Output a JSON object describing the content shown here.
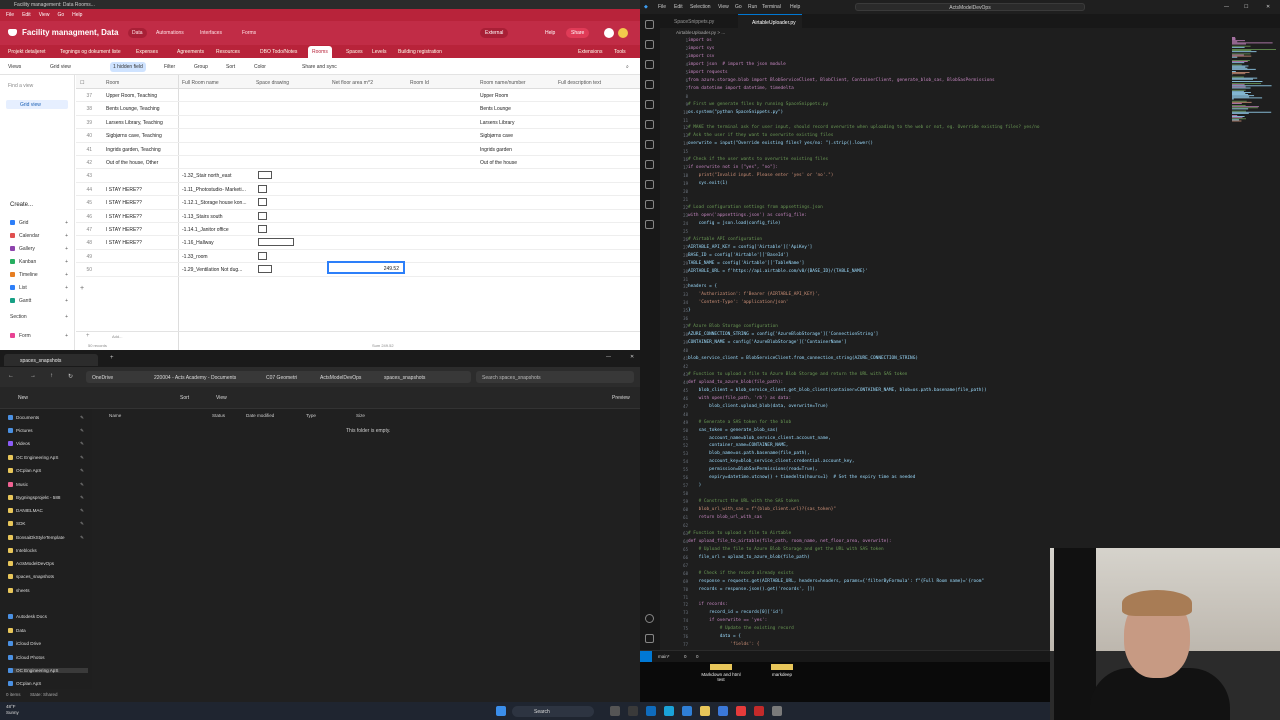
{
  "airtable": {
    "window_title": "Facility management: Data Rooms...",
    "menu": [
      "File",
      "Edit",
      "View",
      "Go",
      "Help"
    ],
    "base_title": "Facility managment, Data",
    "nav": [
      "Data",
      "Automations",
      "Interfaces",
      "Forms"
    ],
    "nav_active": "Data",
    "external_label": "External",
    "help_label": "Help",
    "share_label": "Share",
    "tables": [
      "Projekt detaljeret",
      "Tegnings og dokument liste",
      "Expenses",
      "Agreements",
      "Resources",
      "DBO Todo/Notes",
      "Rooms",
      "Spaces",
      "Levels",
      "Building registration"
    ],
    "active_table": "Rooms",
    "extensions_label": "Extensions",
    "tools_label": "Tools",
    "toolbar": {
      "views": "Views",
      "grid_view": "Grid view",
      "hidden": "1 hidden field",
      "filter": "Filter",
      "group": "Group",
      "sort": "Sort",
      "color": "Color",
      "share_sync": "Share and sync"
    },
    "sidebar": {
      "find": "Find a view",
      "grid_view": "Grid view",
      "create": "Create...",
      "items": [
        "Grid",
        "Calendar",
        "Gallery",
        "Kanban",
        "Timeline",
        "List",
        "Gantt",
        "Section",
        "Form"
      ]
    },
    "columns": [
      "Room",
      "Full Room name",
      "Space drawing",
      "Net floor area m^2",
      "Room Id",
      "Room name/number",
      "Full description text"
    ],
    "rows": [
      {
        "n": "37",
        "room": "Upper Room, Teaching",
        "full": "",
        "thumb": false,
        "number": "Upper Room"
      },
      {
        "n": "38",
        "room": "Bents Lounge, Teaching",
        "full": "",
        "thumb": false,
        "number": "Bents Lounge"
      },
      {
        "n": "39",
        "room": "Larsens Library, Teaching",
        "full": "",
        "thumb": false,
        "number": "Larsens Library"
      },
      {
        "n": "40",
        "room": "Sigbjørns cave, Teaching",
        "full": "",
        "thumb": false,
        "number": "Sigbjørns cave"
      },
      {
        "n": "41",
        "room": "Ingrids garden, Teaching",
        "full": "",
        "thumb": false,
        "number": "Ingrids garden"
      },
      {
        "n": "42",
        "room": "Out of the house, Other",
        "full": "",
        "thumb": false,
        "number": "Out of the house"
      },
      {
        "n": "43",
        "room": "",
        "full": "-1.32_Stair north_east",
        "thumb": true,
        "number": ""
      },
      {
        "n": "44",
        "room": "I STAY HERE??",
        "full": "-1.11_Photostudio- Marketi...",
        "thumb": true,
        "number": ""
      },
      {
        "n": "45",
        "room": "I STAY HERE??",
        "full": "-1.12.1_Storage house kon...",
        "thumb": true,
        "number": ""
      },
      {
        "n": "46",
        "room": "I STAY HERE??",
        "full": "-1.13_Stairs south",
        "thumb": true,
        "number": ""
      },
      {
        "n": "47",
        "room": "I STAY HERE??",
        "full": "-1.14.1_Janitor office",
        "thumb": true,
        "number": ""
      },
      {
        "n": "48",
        "room": "I STAY HERE??",
        "full": "-1.16_Hallway",
        "thumb": true,
        "number": ""
      },
      {
        "n": "49",
        "room": "",
        "full": "-1.33_room",
        "thumb": true,
        "number": ""
      },
      {
        "n": "50",
        "room": "",
        "full": "-1.29_Ventilation Not dug...",
        "thumb": true,
        "number": ""
      }
    ],
    "selected_value": "249.52",
    "add_label": "Add...",
    "records": "50 records",
    "sum": "Sum 249.52"
  },
  "explorer": {
    "tab_title": "spaces_snapshots",
    "breadcrumb": [
      "OneDrive",
      "220004 - Acts Academy - Documents",
      "C07 Geometri",
      "ActsModelDevOps",
      "spaces_snapshots"
    ],
    "search": "Search spaces_snapshots",
    "cmd": {
      "new": "New",
      "sort": "Sort",
      "view": "View",
      "preview": "Preview"
    },
    "columns": [
      "Name",
      "Status",
      "Date modified",
      "Type",
      "Size"
    ],
    "empty": "This folder is empty.",
    "nav": [
      {
        "label": "Documents",
        "pin": true,
        "color": "#4a90e2"
      },
      {
        "label": "Pictures",
        "pin": true,
        "color": "#4a90e2"
      },
      {
        "label": "Videos",
        "pin": true,
        "color": "#8b5cf6"
      },
      {
        "label": "OC Engineering ApS",
        "pin": true,
        "color": "#e8c65a"
      },
      {
        "label": "OCplan ApS",
        "pin": true,
        "color": "#e8c65a"
      },
      {
        "label": "Music",
        "pin": true,
        "color": "#f06292"
      },
      {
        "label": "Bygningsprojekt - 588",
        "pin": true,
        "color": "#e8c65a"
      },
      {
        "label": "DANIELMAC",
        "pin": true,
        "color": "#e8c65a"
      },
      {
        "label": "SDK",
        "pin": true,
        "color": "#e8c65a"
      },
      {
        "label": "BonsaiDkStyleTemplate",
        "pin": true,
        "color": "#e8c65a"
      },
      {
        "label": "Inteblocks",
        "pin": false,
        "color": "#e8c65a"
      },
      {
        "label": "ActsModelDevOps",
        "pin": false,
        "color": "#e8c65a"
      },
      {
        "label": "spaces_snapshots",
        "pin": false,
        "color": "#e8c65a"
      },
      {
        "label": "sheets",
        "pin": false,
        "color": "#e8c65a"
      },
      {
        "label": "Autodesk Docs",
        "pin": false,
        "color": "#4a90e2"
      },
      {
        "label": "Data",
        "pin": false,
        "color": "#e8c65a"
      },
      {
        "label": "iCloud Drive",
        "pin": false,
        "color": "#4a90e2"
      },
      {
        "label": "iCloud Photos",
        "pin": false,
        "color": "#4a90e2"
      },
      {
        "label": "OC Engineering ApS",
        "pin": false,
        "color": "#4a90e2"
      },
      {
        "label": "OCplan ApS",
        "pin": false,
        "color": "#4a90e2"
      }
    ],
    "status": "0 items",
    "state": "State: Shared"
  },
  "vscode": {
    "menu": [
      "File",
      "Edit",
      "Selection",
      "View",
      "Go",
      "Run",
      "Terminal",
      "Help"
    ],
    "search": "ActsModelDevOps",
    "tabs": [
      "SpaceSnippets.py",
      "AirtableUploader.py"
    ],
    "active_tab": "AirtableUploader.py",
    "breadcrumb": "AirtableUploader.py > ...",
    "lines": [
      {
        "t": "import os",
        "c": "kw"
      },
      {
        "t": "import sys",
        "c": "kw"
      },
      {
        "t": "import csv",
        "c": "kw"
      },
      {
        "t": "import json  # import the json module",
        "c": "kw"
      },
      {
        "t": "import requests",
        "c": "kw"
      },
      {
        "t": "from azure.storage.blob import BlobServiceClient, BlobClient, ContainerClient, generate_blob_sas, BlobSasPermissions",
        "c": "kw"
      },
      {
        "t": "from datetime import datetime, timedelta",
        "c": "kw"
      },
      {
        "t": "",
        "c": ""
      },
      {
        "t": "# First we generate files by running SpaceSnippets.py",
        "c": "cm"
      },
      {
        "t": "os.system(\"python SpaceSnippets.py\")",
        "c": "df"
      },
      {
        "t": "",
        "c": ""
      },
      {
        "t": "# MAKE the terminal ask for user input, should record overwrite when uploading to the web or not, eg. Override existing files? yes/no",
        "c": "cm"
      },
      {
        "t": "# Ask the user if they want to overwrite existing files",
        "c": "cm"
      },
      {
        "t": "overwrite = input(\"Override existing files? yes/no: \").strip().lower()",
        "c": "df"
      },
      {
        "t": "",
        "c": ""
      },
      {
        "t": "# Check if the user wants to overwrite existing files",
        "c": "cm"
      },
      {
        "t": "if overwrite not in [\"yes\", \"no\"]:",
        "c": "kw"
      },
      {
        "t": "    print(\"Invalid input. Please enter 'yes' or 'no'.\")",
        "c": "st"
      },
      {
        "t": "    sys.exit(1)",
        "c": "df"
      },
      {
        "t": "",
        "c": ""
      },
      {
        "t": "",
        "c": ""
      },
      {
        "t": "# Load configuration settings from appsettings.json",
        "c": "cm"
      },
      {
        "t": "with open('appsettings.json') as config_file:",
        "c": "kw"
      },
      {
        "t": "    config = json.load(config_file)",
        "c": "df"
      },
      {
        "t": "",
        "c": ""
      },
      {
        "t": "# Airtable API configuration",
        "c": "cm"
      },
      {
        "t": "AIRTABLE_API_KEY = config['Airtable']['ApiKey']",
        "c": "df"
      },
      {
        "t": "BASE_ID = config['Airtable']['BaseId']",
        "c": "df"
      },
      {
        "t": "TABLE_NAME = config['Airtable']['TableName']",
        "c": "df"
      },
      {
        "t": "AIRTABLE_URL = f'https://api.airtable.com/v0/{BASE_ID}/{TABLE_NAME}'",
        "c": "df"
      },
      {
        "t": "",
        "c": ""
      },
      {
        "t": "headers = {",
        "c": "df"
      },
      {
        "t": "    'Authorization': f'Bearer {AIRTABLE_API_KEY}',",
        "c": "st"
      },
      {
        "t": "    'Content-Type': 'application/json'",
        "c": "st"
      },
      {
        "t": "}",
        "c": "df"
      },
      {
        "t": "",
        "c": ""
      },
      {
        "t": "# Azure Blob Storage configuration",
        "c": "cm"
      },
      {
        "t": "AZURE_CONNECTION_STRING = config['AzureBlobStorage']['ConnectionString']",
        "c": "df"
      },
      {
        "t": "CONTAINER_NAME = config['AzureBlobStorage']['ContainerName']",
        "c": "df"
      },
      {
        "t": "",
        "c": ""
      },
      {
        "t": "blob_service_client = BlobServiceClient.from_connection_string(AZURE_CONNECTION_STRING)",
        "c": "df"
      },
      {
        "t": "",
        "c": ""
      },
      {
        "t": "# Function to upload a file to Azure Blob Storage and return the URL with SAS token",
        "c": "cm"
      },
      {
        "t": "def upload_to_azure_blob(file_path):",
        "c": "kw"
      },
      {
        "t": "    blob_client = blob_service_client.get_blob_client(container=CONTAINER_NAME, blob=os.path.basename(file_path))",
        "c": "df"
      },
      {
        "t": "    with open(file_path, 'rb') as data:",
        "c": "kw"
      },
      {
        "t": "        blob_client.upload_blob(data, overwrite=True)",
        "c": "df"
      },
      {
        "t": "",
        "c": ""
      },
      {
        "t": "    # Generate a SAS token for the blob",
        "c": "cm"
      },
      {
        "t": "    sas_token = generate_blob_sas(",
        "c": "df"
      },
      {
        "t": "        account_name=blob_service_client.account_name,",
        "c": "df"
      },
      {
        "t": "        container_name=CONTAINER_NAME,",
        "c": "df"
      },
      {
        "t": "        blob_name=os.path.basename(file_path),",
        "c": "df"
      },
      {
        "t": "        account_key=blob_service_client.credential.account_key,",
        "c": "df"
      },
      {
        "t": "        permission=BlobSasPermissions(read=True),",
        "c": "df"
      },
      {
        "t": "        expiry=datetime.utcnow() + timedelta(hours=1)  # Set the expiry time as needed",
        "c": "df"
      },
      {
        "t": "    )",
        "c": "df"
      },
      {
        "t": "",
        "c": ""
      },
      {
        "t": "    # Construct the URL with the SAS token",
        "c": "cm"
      },
      {
        "t": "    blob_url_with_sas = f\"{blob_client.url}?{sas_token}\"",
        "c": "st"
      },
      {
        "t": "    return blob_url_with_sas",
        "c": "kw"
      },
      {
        "t": "",
        "c": ""
      },
      {
        "t": "# Function to upload a file to Airtable",
        "c": "cm"
      },
      {
        "t": "def upload_file_to_airtable(file_path, room_name, net_floor_area, overwrite):",
        "c": "kw"
      },
      {
        "t": "    # Upload the file to Azure Blob Storage and get the URL with SAS token",
        "c": "cm"
      },
      {
        "t": "    file_url = upload_to_azure_blob(file_path)",
        "c": "df"
      },
      {
        "t": "",
        "c": ""
      },
      {
        "t": "    # Check if the record already exists",
        "c": "cm"
      },
      {
        "t": "    response = requests.get(AIRTABLE_URL, headers=headers, params={'filterByFormula': f\"{Full Room name}='{room\"",
        "c": "df"
      },
      {
        "t": "    records = response.json().get('records', [])",
        "c": "df"
      },
      {
        "t": "",
        "c": ""
      },
      {
        "t": "    if records:",
        "c": "kw"
      },
      {
        "t": "        record_id = records[0]['id']",
        "c": "df"
      },
      {
        "t": "        if overwrite == 'yes':",
        "c": "kw"
      },
      {
        "t": "            # Update the existing record",
        "c": "cm"
      },
      {
        "t": "            data = {",
        "c": "df"
      },
      {
        "t": "                'fields': {",
        "c": "st"
      }
    ],
    "status_branch": "main*",
    "status_errors": "0",
    "status_warnings": "0"
  },
  "desktop": {
    "items": [
      "Markdown and html test",
      "markdeep"
    ]
  },
  "taskbar": {
    "weather_temp": "48°F",
    "weather_desc": "Sunny",
    "search": "Search"
  }
}
